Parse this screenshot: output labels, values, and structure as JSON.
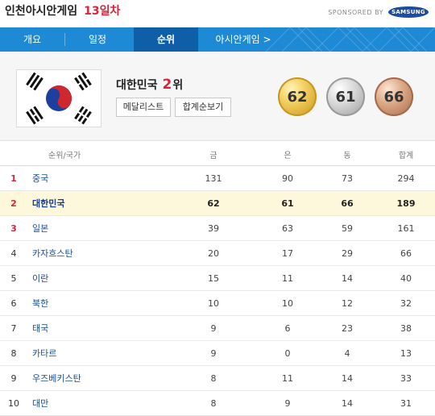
{
  "header": {
    "title": "인천아시안게임",
    "day": "13일차",
    "sponsor_label": "SPONSORED BY",
    "sponsor_logo_text": "SAMSUNG"
  },
  "nav": {
    "tabs": [
      {
        "label": "개요"
      },
      {
        "label": "일정"
      },
      {
        "label": "순위"
      },
      {
        "label": "아시안게임 >"
      }
    ],
    "active": "순위"
  },
  "summary": {
    "country": "대한민국",
    "rank": "2",
    "rank_suffix": "위",
    "medal_list_button": "메달리스트",
    "total_rank_button": "합계순보기",
    "gold": "62",
    "silver": "61",
    "bronze": "66"
  },
  "table": {
    "headers": [
      "순위/국가",
      "금",
      "은",
      "동",
      "합계"
    ],
    "rows": [
      {
        "rank": "1",
        "country": "중국",
        "gold": "131",
        "silver": "90",
        "bronze": "73",
        "total": "294"
      },
      {
        "rank": "2",
        "country": "대한민국",
        "gold": "62",
        "silver": "61",
        "bronze": "66",
        "total": "189"
      },
      {
        "rank": "3",
        "country": "일본",
        "gold": "39",
        "silver": "63",
        "bronze": "59",
        "total": "161"
      },
      {
        "rank": "4",
        "country": "카자흐스탄",
        "gold": "20",
        "silver": "17",
        "bronze": "29",
        "total": "66"
      },
      {
        "rank": "5",
        "country": "이란",
        "gold": "15",
        "silver": "11",
        "bronze": "14",
        "total": "40"
      },
      {
        "rank": "6",
        "country": "북한",
        "gold": "10",
        "silver": "10",
        "bronze": "12",
        "total": "32"
      },
      {
        "rank": "7",
        "country": "태국",
        "gold": "9",
        "silver": "6",
        "bronze": "23",
        "total": "38"
      },
      {
        "rank": "8",
        "country": "카타르",
        "gold": "9",
        "silver": "0",
        "bronze": "4",
        "total": "13"
      },
      {
        "rank": "9",
        "country": "우즈베키스탄",
        "gold": "8",
        "silver": "11",
        "bronze": "14",
        "total": "33"
      },
      {
        "rank": "10",
        "country": "대만",
        "gold": "8",
        "silver": "9",
        "bronze": "14",
        "total": "31"
      }
    ]
  },
  "colors": {
    "nav_blue": "#1e8ad6",
    "nav_active": "#0e5fa8",
    "rank_red": "#d6263b",
    "highlight_row": "#fdf8dc",
    "country_link": "#1a4c9c"
  },
  "icons": {
    "flag": "south-korea-flag-icon",
    "gold_medal": "gold-medal-icon",
    "silver_medal": "silver-medal-icon",
    "bronze_medal": "bronze-medal-icon"
  }
}
